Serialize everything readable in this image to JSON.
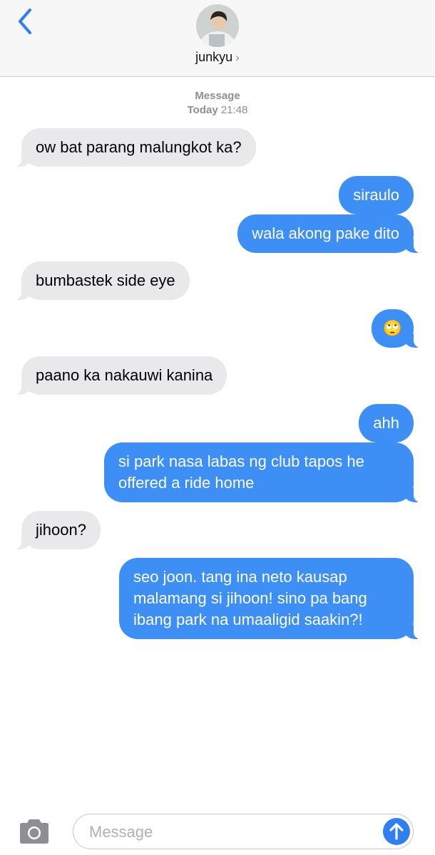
{
  "header": {
    "contact_name": "junkyu",
    "chevron": "›"
  },
  "timestamp": {
    "label": "Message",
    "day": "Today",
    "time": "21:48"
  },
  "messages": [
    {
      "from": "them",
      "text": "ow bat parang malungkot ka?"
    },
    {
      "from": "me",
      "text": "siraulo"
    },
    {
      "from": "me",
      "text": "wala akong pake dito"
    },
    {
      "from": "them",
      "text": "bumbastek side eye"
    },
    {
      "from": "me",
      "text": "🙄",
      "icon": "eye-roll-emoji"
    },
    {
      "from": "them",
      "text": "paano ka nakauwi kanina"
    },
    {
      "from": "me",
      "text": "ahh"
    },
    {
      "from": "me",
      "text": "si park nasa labas ng club tapos he offered a ride home"
    },
    {
      "from": "them",
      "text": "jihoon?"
    },
    {
      "from": "me",
      "text": "seo joon. tang ina neto kausap malamang si jihoon! sino pa bang ibang park na umaaligid saakin?!"
    }
  ],
  "composer": {
    "placeholder": "Message",
    "value": ""
  },
  "colors": {
    "outgoing_bubble": "#3d8ff5",
    "incoming_bubble": "#e9e9eb",
    "accent": "#2f7ff2"
  },
  "icons": {
    "back": "chevron-left-icon",
    "camera": "camera-icon",
    "send": "arrow-up-icon"
  }
}
